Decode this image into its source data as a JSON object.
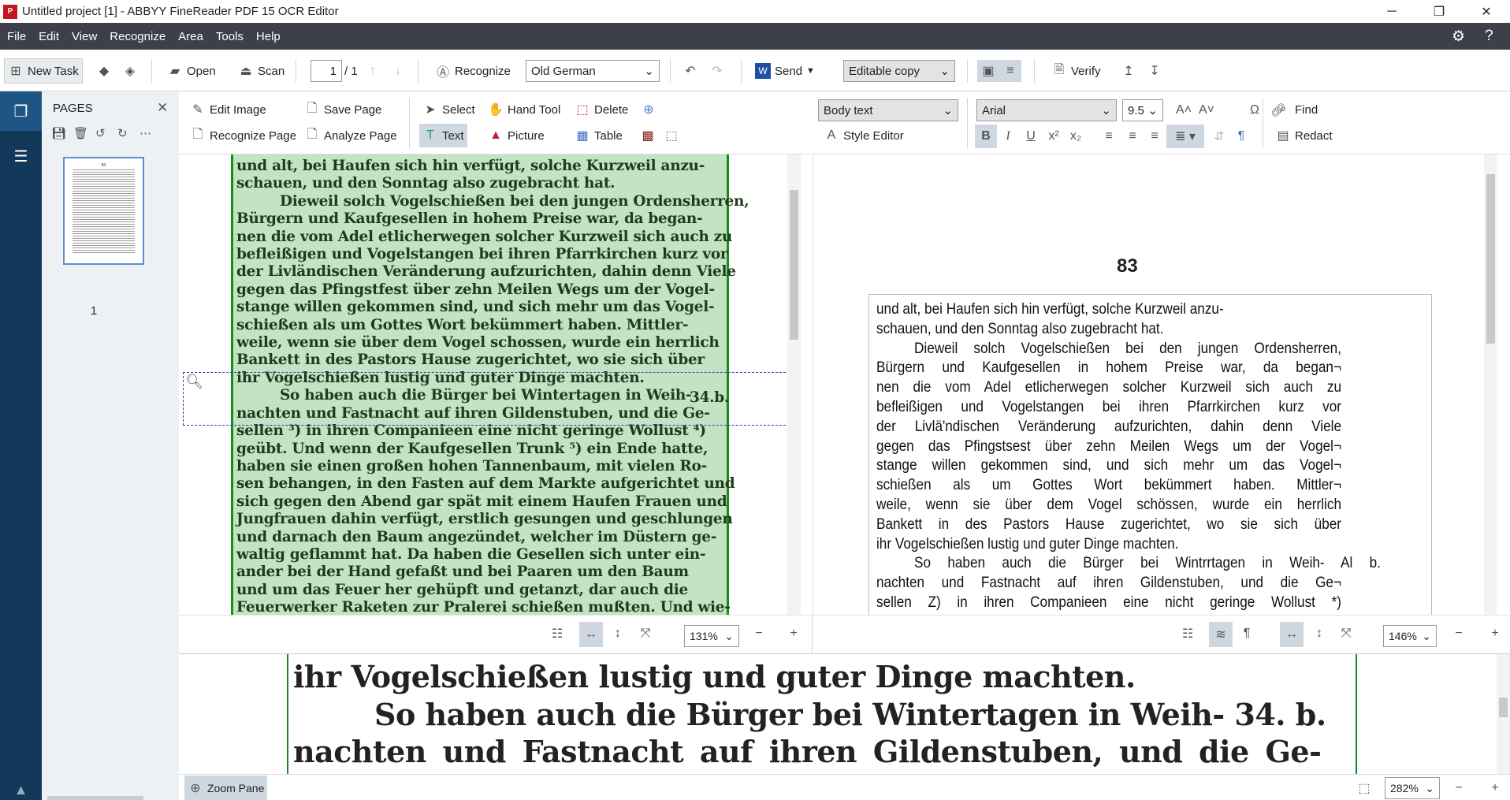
{
  "window": {
    "title": "Untitled project [1] - ABBYY FineReader PDF 15 OCR Editor",
    "logo": "PDF"
  },
  "menu": [
    "File",
    "Edit",
    "View",
    "Recognize",
    "Area",
    "Tools",
    "Help"
  ],
  "toolbar": {
    "new_task": "New Task",
    "open": "Open",
    "scan": "Scan",
    "page_current": "1",
    "page_total": "/ 1",
    "recognize": "Recognize",
    "language": "Old German",
    "send": "Send",
    "mode": "Editable copy",
    "verify": "Verify"
  },
  "pages_panel": {
    "title": "PAGES",
    "thumbnail_label": "1",
    "thumbnail_number": "83"
  },
  "image_toolbar": {
    "edit_image": "Edit Image",
    "save_page": "Save Page",
    "recognize_page": "Recognize Page",
    "analyze_page": "Analyze Page",
    "select": "Select",
    "hand_tool": "Hand Tool",
    "delete": "Delete",
    "text": "Text",
    "picture": "Picture",
    "table": "Table"
  },
  "text_toolbar": {
    "style": "Body text",
    "style_editor": "Style Editor",
    "font": "Arial",
    "font_size": "9.5",
    "find": "Find",
    "redact": "Redact",
    "bold": "B",
    "italic": "I",
    "underline": "U"
  },
  "image_pane": {
    "zoom": "131%",
    "margin_note": "34.b.",
    "lines": [
      "und alt, bei Haufen sich hin verfügt, solche Kurzweil anzu-",
      "schauen, und den Sonntag also zugebracht hat.",
      "Dieweil solch Vogelschießen bei den jungen Ordensherren,",
      "Bürgern und Kaufgesellen in hohem Preise war, da began-",
      "nen die vom Adel etlicherwegen solcher Kurzweil sich auch zu",
      "befleißigen und Vogelstangen bei ihren Pfarrkirchen kurz vor",
      "der Livländischen Veränderung aufzurichten, dahin denn Viele",
      "gegen das Pfingstfest über zehn Meilen Wegs um der Vogel-",
      "stange willen gekommen sind, und sich mehr um das Vogel-",
      "schießen als um Gottes Wort bekümmert haben. Mittler-",
      "weile, wenn sie über dem Vogel schossen, wurde ein herrlich",
      "Bankett in des Pastors Hause zugerichtet, wo sie sich über",
      "ihr Vogelschießen lustig und guter Dinge machten.",
      "So haben auch die Bürger bei Wintertagen in Weih-",
      "nachten und Fastnacht auf ihren Gildenstuben, und die Ge-",
      "sellen ³) in ihren Companieen eine nicht geringe Wollust ⁴)",
      "geübt. Und wenn der Kaufgesellen Trunk ⁵) ein Ende hatte,",
      "haben sie einen großen hohen Tannenbaum, mit vielen Ro-",
      "sen behangen, in den Fasten auf dem Markte aufgerichtet und",
      "sich gegen den Abend gar spät mit einem Haufen Frauen und",
      "Jungfrauen dahin verfügt, erstlich gesungen und geschlungen",
      "und darnach den Baum angezündet, welcher im Düstern ge-",
      "waltig geflammt hat. Da haben die Gesellen sich unter ein-",
      "ander bei der Hand gefaßt und bei Paaren um den Baum",
      "und um das Feuer her gehüpft und getanzt, dar auch die",
      "Feuerwerker Raketen zur Pralerei schießen mußten. Und wie-"
    ]
  },
  "text_pane": {
    "zoom": "146%",
    "page_number": "83",
    "lines": [
      "und alt, bei Haufen sich hin verfügt, solche Kurzweil anzu-",
      "schauen, und den Sonntag also zugebracht hat.",
      "Dieweil solch Vogelschießen bei den jungen Ordensherren,",
      "Bürgern und Kaufgesellen in hohem Preise war, da began¬",
      "nen die vom Adel etlicherwegen solcher Kurzweil sich auch zu",
      "befleißigen und Vogelstangen bei ihren Pfarrkirchen kurz vor",
      "der Livlä'ndischen Veränderung aufzurichten, dahin denn Viele",
      "gegen das Pfingstsest über zehn Meilen Wegs um der Vogel¬",
      "stange willen gekommen sind, und sich mehr um das Vogel¬",
      "schießen als um Gottes Wort bekümmert haben. Mittler¬",
      "weile, wenn sie über dem Vogel schössen, wurde ein herrlich",
      "Bankett in des Pastors Hause zugerichtet, wo sie sich über",
      "ihr Vogelschießen lustig und guter Dinge machten.",
      "So haben auch die Bürger bei Wintrrtagen in Weih- Al b.",
      "nachten und Fastnacht auf ihren Gildenstuben, und die Ge¬",
      "sellen Z) in ihren Companieen eine nicht geringe Wollust *)"
    ]
  },
  "zoom_pane": {
    "label": "Zoom Pane",
    "zoom": "282%",
    "lines": [
      "ihr Vogelschießen lustig und guter Dinge machten.",
      "So haben auch die Bürger bei Wintertagen in Weih- 34. b.",
      "nachten und Fastnacht auf ihren Gildenstuben, und die Ge-"
    ]
  },
  "colors": {
    "menubar": "#3d4049",
    "sidebar": "#12395a",
    "text_block": "#c3e3c3",
    "block_border": "#1a8a1a",
    "uncertain_highlight": "#7ef0f5"
  }
}
